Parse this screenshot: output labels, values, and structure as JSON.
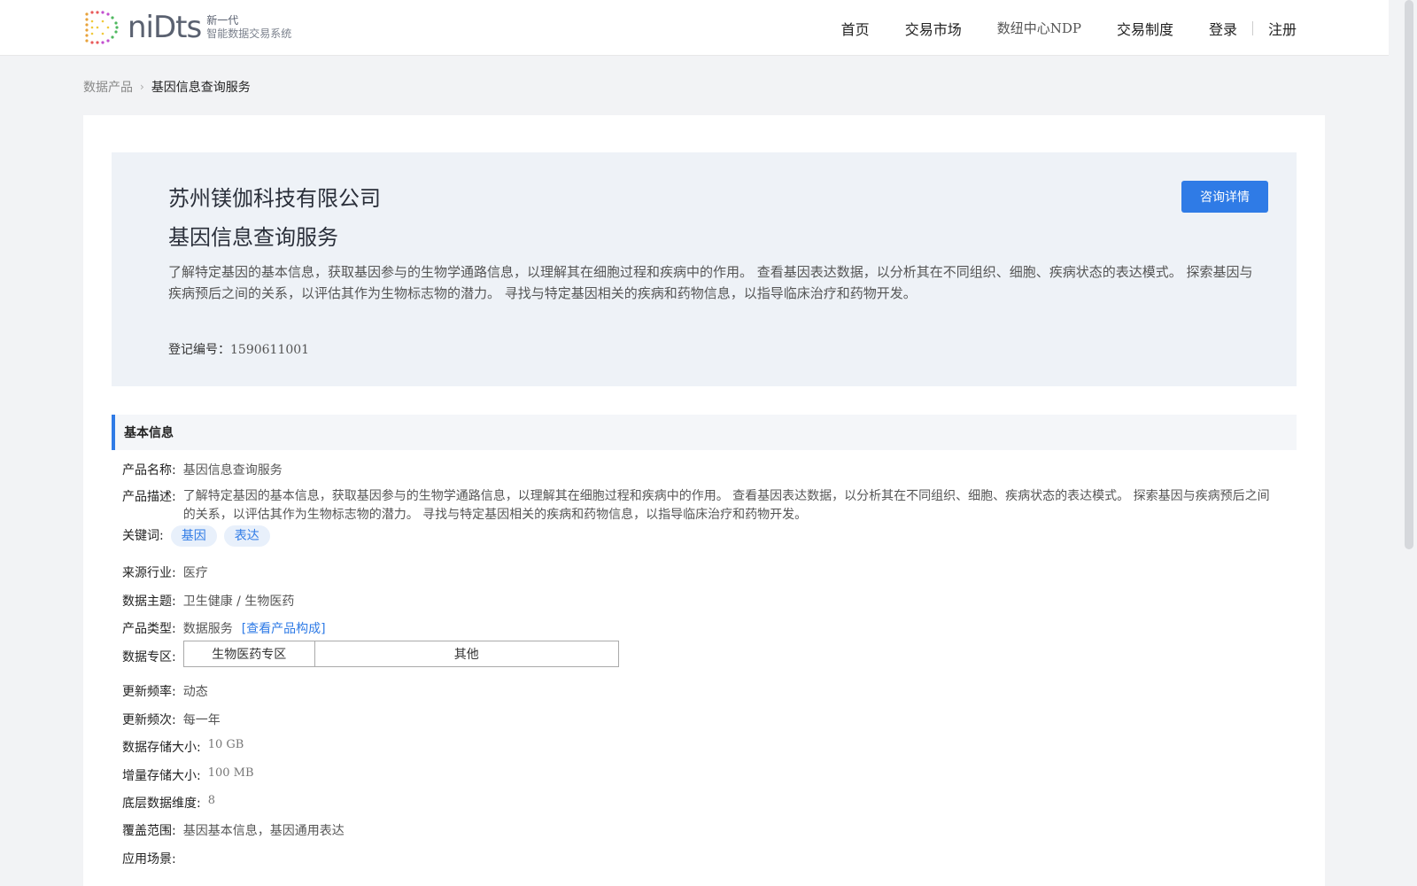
{
  "header": {
    "logo_word": "niDts",
    "logo_tag_line1": "新一代",
    "logo_tag_line2": "智能数据交易系统",
    "nav": [
      "首页",
      "交易市场",
      "数纽中心NDP",
      "交易制度"
    ],
    "login": "登录",
    "register": "注册"
  },
  "breadcrumb": {
    "parent": "数据产品",
    "current": "基因信息查询服务"
  },
  "hero": {
    "company": "苏州镁伽科技有限公司",
    "title": "基因信息查询服务",
    "description": "了解特定基因的基本信息，获取基因参与的生物学通路信息，以理解其在细胞过程和疾病中的作用。 查看基因表达数据，以分析其在不同组织、细胞、疾病状态的表达模式。 探索基因与疾病预后之间的关系，以评估其作为生物标志物的潜力。 寻找与特定基因相关的疾病和药物信息，以指导临床治疗和药物开发。",
    "reg_label": "登记编号：",
    "reg_value": "1590611001",
    "consult_button": "咨询详情"
  },
  "basic_info": {
    "section_title": "基本信息",
    "name_label": "产品名称:",
    "name_value": "基因信息查询服务",
    "desc_label": "产品描述:",
    "desc_value": "了解特定基因的基本信息，获取基因参与的生物学通路信息，以理解其在细胞过程和疾病中的作用。 查看基因表达数据，以分析其在不同组织、细胞、疾病状态的表达模式。 探索基因与疾病预后之间的关系，以评估其作为生物标志物的潜力。 寻找与特定基因相关的疾病和药物信息，以指导临床治疗和药物开发。",
    "keywords_label": "关键词:",
    "keywords": [
      "基因",
      "表达"
    ],
    "industry_label": "来源行业:",
    "industry_value": "医疗",
    "theme_label": "数据主题:",
    "theme_value": "卫生健康 / 生物医药",
    "type_label": "产品类型:",
    "type_value": "数据服务",
    "type_link": "[查看产品构成]",
    "zone_label": "数据专区:",
    "zone_values": [
      "生物医药专区",
      "其他"
    ],
    "freq_label": "更新频率:",
    "freq_value": "动态",
    "times_label": "更新频次:",
    "times_value": "每一年",
    "storage_label": "数据存储大小:",
    "storage_value": "10 GB",
    "inc_label": "增量存储大小:",
    "inc_value": "100 MB",
    "dim_label": "底层数据维度:",
    "dim_value": "8",
    "coverage_label": "覆盖范围:",
    "coverage_value": "基因基本信息，基因通用表达",
    "scenario_label": "应用场景:"
  }
}
